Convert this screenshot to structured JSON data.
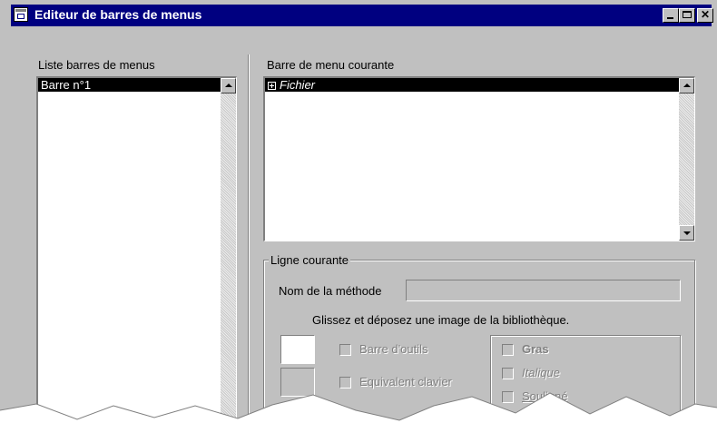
{
  "window": {
    "title": "Editeur de barres de menus",
    "icon": "menu-editor-app-icon",
    "controls": [
      "minimize-icon",
      "maximize-icon",
      "close-icon"
    ],
    "close_glyph": "✕"
  },
  "left_panel": {
    "label": "Liste barres de menus",
    "items": [
      "Barre n°1"
    ]
  },
  "right_panel": {
    "label": "Barre de menu courante",
    "items": [
      {
        "label": "Fichier",
        "expand_icon": "plus-box-icon"
      }
    ]
  },
  "current_line": {
    "group_label": "Ligne courante",
    "method_label": "Nom de la méthode",
    "method_value": "",
    "hint": "Glissez et déposez une image de la bibliothèque.",
    "checkboxes_left": [
      {
        "label": "Barre d'outils",
        "checked": false
      },
      {
        "label": "Equivalent clavier",
        "checked": false
      }
    ],
    "style_checkboxes": [
      {
        "label": "Gras",
        "checked": false
      },
      {
        "label": "Italique",
        "checked": false
      },
      {
        "label": "Souligné",
        "checked": false
      }
    ]
  },
  "colors": {
    "titlebar": "#000080",
    "face": "#c0c0c0",
    "selection": "#000000"
  }
}
